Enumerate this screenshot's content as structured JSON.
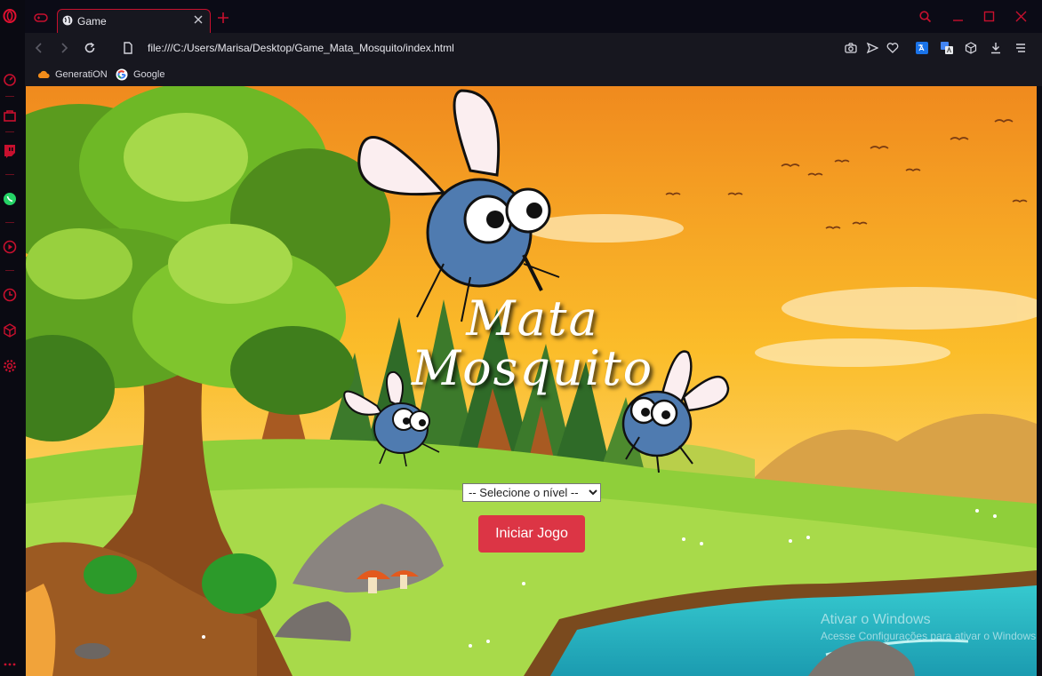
{
  "browser": {
    "tab_title": "Game",
    "url": "file:///C:/Users/Marisa/Desktop/Game_Mata_Mosquito/index.html",
    "accent_color": "#c8102e",
    "bookmarks": [
      {
        "label": "GeneratiON",
        "icon": "cloud-icon"
      },
      {
        "label": "Google",
        "icon": "google-icon"
      }
    ]
  },
  "game": {
    "title_line1": "Mata",
    "title_line2": "Mosquito",
    "level_select": {
      "selected": "-- Selecione o nível --"
    },
    "start_button_label": "Iniciar Jogo",
    "button_color": "#dc3545"
  },
  "os_watermark": {
    "line1": "Ativar o Windows",
    "line2": "Acesse Configurações para ativar o Windows."
  }
}
